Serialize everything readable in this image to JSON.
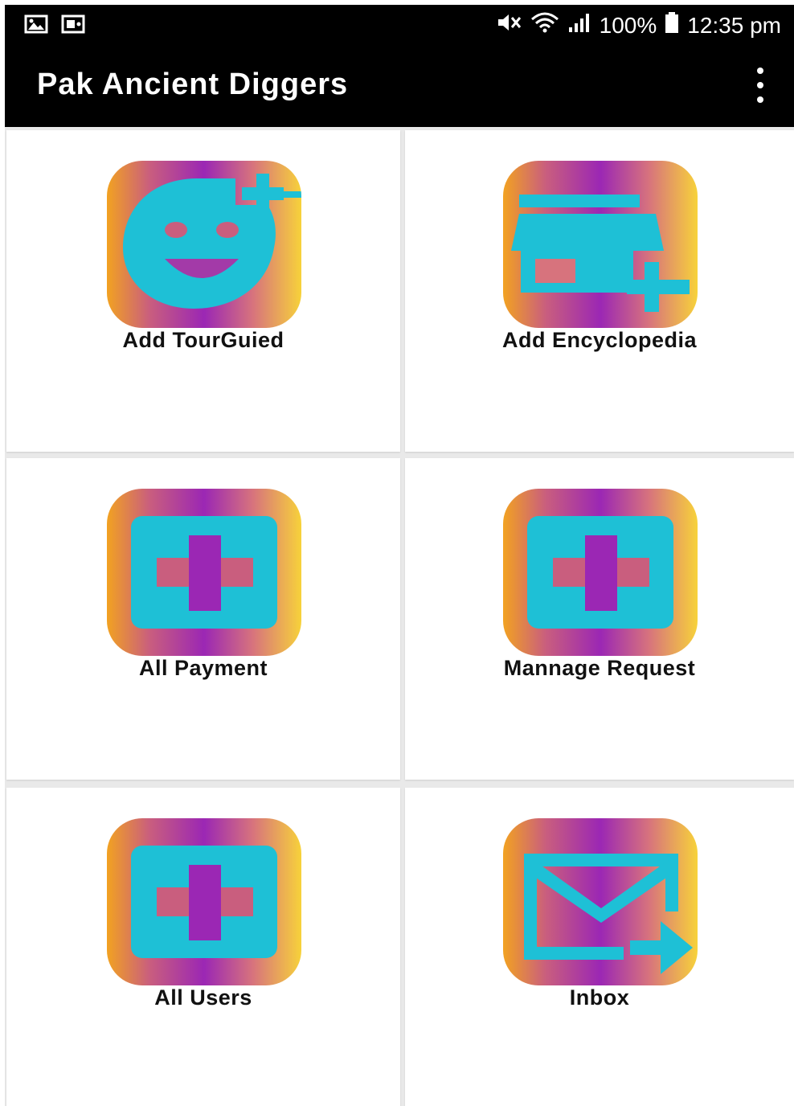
{
  "status_bar": {
    "left_icons": [
      "gallery-icon",
      "screenshot-icon"
    ],
    "right_icons": [
      "mute-icon",
      "wifi-icon",
      "signal-icon",
      "battery-icon"
    ],
    "battery": "100%",
    "time": "12:35 pm"
  },
  "app_bar": {
    "title": "Pak Ancient Diggers",
    "menu_icon": "more-vert-icon"
  },
  "tiles": [
    {
      "label": "Add TourGuied",
      "icon": "add-face-icon"
    },
    {
      "label": "Add Encyclopedia",
      "icon": "add-store-icon"
    },
    {
      "label": "All Payment",
      "icon": "add-box-icon"
    },
    {
      "label": "Mannage Request",
      "icon": "add-box-icon"
    },
    {
      "label": "All Users",
      "icon": "add-box-icon"
    },
    {
      "label": "Inbox",
      "icon": "forward-mail-icon"
    }
  ],
  "colors": {
    "bar_background": "#000000",
    "icon_fill": "#1ec0d6",
    "gradient": [
      "#f2a221",
      "#9b27b4",
      "#f7d23a"
    ],
    "label_text": "#111111"
  }
}
